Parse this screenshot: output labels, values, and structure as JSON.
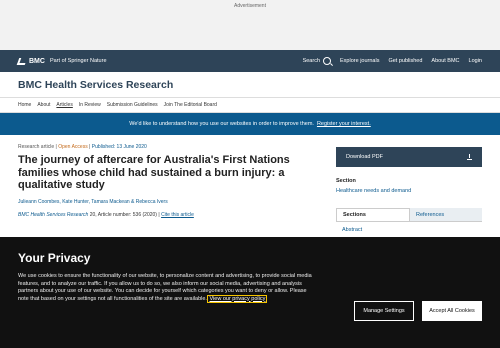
{
  "ad": {
    "label": "Advertisement"
  },
  "brand": {
    "logo": "BMC",
    "sub": "Part of Springer Nature",
    "search": "Search",
    "links": [
      "Explore journals",
      "Get published",
      "About BMC",
      "Login"
    ]
  },
  "journal": {
    "title": "BMC Health Services Research"
  },
  "nav": {
    "items": [
      "Home",
      "About",
      "Articles",
      "In Review",
      "Submission Guidelines",
      "Join The Editorial Board"
    ],
    "active": "Articles"
  },
  "notice": {
    "text": "We'd like to understand how you use our websites in order to improve them.",
    "link": "Register your interest."
  },
  "article": {
    "type": "Research article",
    "access": "Open Access",
    "published": "Published: 13 June 2020",
    "title": "The journey of aftercare for Australia's First Nations families whose child had sustained a burn injury: a qualitative study",
    "authors": "Julieann Coombes, Kate Hunter, Tamara Mackean & Rebecca Ivers",
    "citation_journal": "BMC Health Services Research",
    "citation_rest": " 20, Article number: 536 (2020)",
    "cite_link": "Cite this article"
  },
  "sidebar": {
    "download": "Download PDF",
    "section_label": "Section",
    "section_value": "Healthcare needs and demand",
    "tabs": [
      "Sections",
      "References"
    ],
    "toc_first": "Abstract"
  },
  "privacy": {
    "title": "Your Privacy",
    "text": "We use cookies to ensure the functionality of our website, to personalize content and advertising, to provide social media features, and to analyze our traffic. If you allow us to do so, we also inform our social media, advertising and analysis partners about your use of our website. You can decide for yourself which categories you want to deny or allow. Please note that based on your settings not all functionalities of the site are available.",
    "link": "View our privacy policy",
    "manage": "Manage Settings",
    "accept": "Accept All Cookies"
  }
}
